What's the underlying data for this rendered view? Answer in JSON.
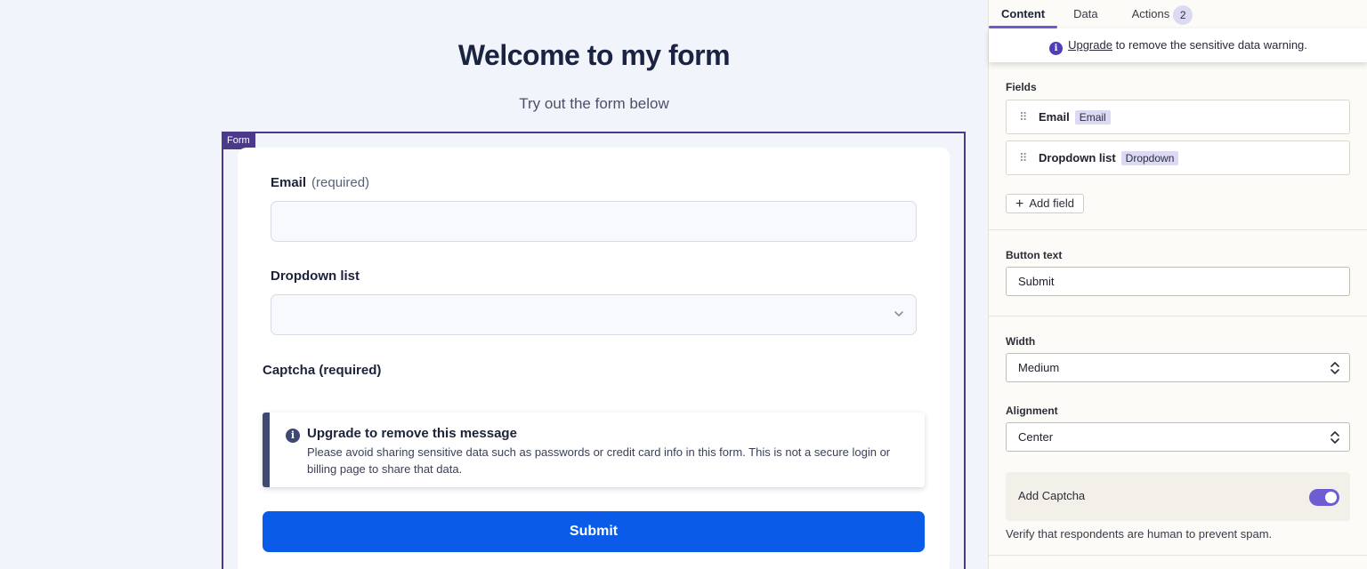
{
  "form": {
    "title": "Welcome to my form",
    "subtitle": "Try out the form below",
    "frame_tag": "Form",
    "email_label": "Email",
    "email_required": "(required)",
    "dropdown_label": "Dropdown list",
    "captcha_label": "Captcha (required)",
    "notice_title": "Upgrade to remove this message",
    "notice_body": "Please avoid sharing sensitive data such as passwords or credit card info in this form. This is not a secure login or billing page to share that data.",
    "submit_label": "Submit"
  },
  "panel": {
    "tabs": [
      {
        "label": "Content",
        "active": true
      },
      {
        "label": "Data",
        "active": false
      },
      {
        "label": "Actions",
        "active": false,
        "count": "2"
      }
    ],
    "banner_link": "Upgrade",
    "banner_text": " to remove the sensitive data warning.",
    "fields_label": "Fields",
    "fields": [
      {
        "name": "Email",
        "type": "Email"
      },
      {
        "name": "Dropdown list",
        "type": "Dropdown"
      }
    ],
    "add_field_label": "Add field",
    "button_text_label": "Button text",
    "button_text_value": "Submit",
    "width_label": "Width",
    "width_value": "Medium",
    "alignment_label": "Alignment",
    "alignment_value": "Center",
    "captcha_label": "Add Captcha",
    "captcha_enabled": true,
    "captcha_help": "Verify that respondents are human to prevent spam."
  },
  "colors": {
    "accent": "#6c5dd3",
    "submit": "#0a5be8",
    "frame": "#4b3a8c"
  }
}
